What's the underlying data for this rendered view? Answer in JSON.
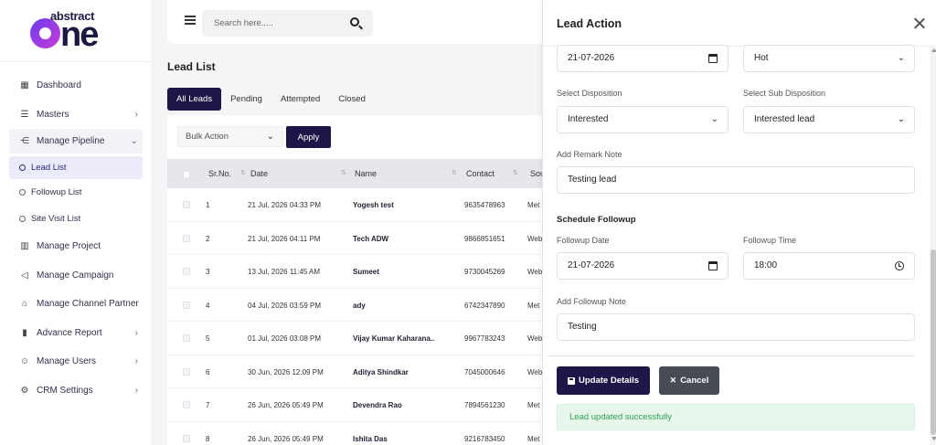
{
  "logo": {
    "top": "abstract",
    "big_prefix": "",
    "big_suffix": "ne"
  },
  "sidebar": {
    "items": [
      {
        "label": "Dashboard",
        "icon": "dashboard-icon"
      },
      {
        "label": "Masters",
        "icon": "list-icon"
      },
      {
        "label": "Manage Pipeline",
        "icon": "pipeline-icon"
      },
      {
        "label": "Lead List"
      },
      {
        "label": "Followup List"
      },
      {
        "label": "Site Visit List"
      },
      {
        "label": "Manage Project",
        "icon": "building-icon"
      },
      {
        "label": "Manage Campaign",
        "icon": "megaphone-icon"
      },
      {
        "label": "Manage Channel Partner",
        "icon": "handshake-icon"
      },
      {
        "label": "Advance Report",
        "icon": "bar-chart-icon"
      },
      {
        "label": "Manage Users",
        "icon": "users-icon"
      },
      {
        "label": "CRM Settings",
        "icon": "gear-icon"
      }
    ]
  },
  "header": {
    "search_placeholder": "Search here....."
  },
  "main": {
    "title": "Lead List",
    "tabs": [
      "All Leads",
      "Pending",
      "Attempted",
      "Closed"
    ],
    "bulk_action": "Bulk Action",
    "apply": "Apply",
    "columns": [
      "Sr.No.",
      "Date",
      "Name",
      "Contact",
      "Sou"
    ],
    "rows": [
      {
        "sr": "1",
        "date": "21 Jul, 2026 04:33 PM",
        "name": "Yogesh test",
        "contact": "9635478963",
        "source": "Met"
      },
      {
        "sr": "2",
        "date": "21 Jul, 2026 04:11 PM",
        "name": "Tech ADW",
        "contact": "9866851651",
        "source": "Web"
      },
      {
        "sr": "3",
        "date": "13 Jul, 2026 11:45 AM",
        "name": "Sumeet",
        "contact": "9730045269",
        "source": "Web"
      },
      {
        "sr": "4",
        "date": "04 Jul, 2026 03:59 PM",
        "name": "ady",
        "contact": "6742347890",
        "source": "Met"
      },
      {
        "sr": "5",
        "date": "01 Jul, 2026 03:08 PM",
        "name": "Vijay Kumar Kaharana..",
        "contact": "9967783243",
        "source": "Web"
      },
      {
        "sr": "6",
        "date": "30 Jun, 2026 12:09 PM",
        "name": "Aditya Shindkar",
        "contact": "7045000646",
        "source": "Web"
      },
      {
        "sr": "7",
        "date": "26 Jun, 2026 05:49 PM",
        "name": "Devendra Rao",
        "contact": "7894561230",
        "source": "Met"
      },
      {
        "sr": "8",
        "date": "26 Jun, 2026 05:49 PM",
        "name": "Ishita Das",
        "contact": "9216783450",
        "source": "Met"
      }
    ]
  },
  "drawer": {
    "title": "Lead Action",
    "date_value": "21-07-2026",
    "status_value": "Hot",
    "disposition_label": "Select Disposition",
    "disposition_value": "Interested",
    "sub_disposition_label": "Select Sub Disposition",
    "sub_disposition_value": "Interested lead",
    "remark_label": "Add Remark Note",
    "remark_value": "Testing lead",
    "schedule_title": "Schedule Followup",
    "followup_date_label": "Followup Date",
    "followup_date_value": "21-07-2026",
    "followup_time_label": "Followup Time",
    "followup_time_value": "18:00",
    "followup_note_label": "Add Followup Note",
    "followup_note_value": "Testing",
    "update_label": "Update Details",
    "cancel_label": "Cancel",
    "alert": "Lead updated successfully"
  }
}
